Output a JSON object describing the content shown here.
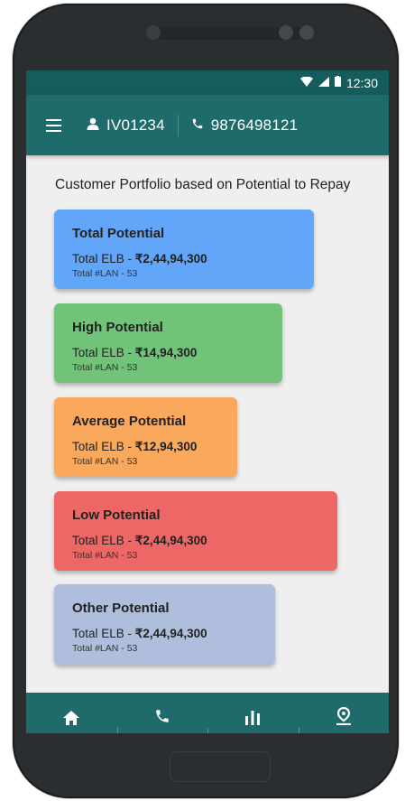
{
  "status_bar": {
    "time": "12:30",
    "icons": [
      "wifi-icon",
      "signal-icon",
      "battery-icon"
    ]
  },
  "app_bar": {
    "menu_icon": "hamburger-menu-icon",
    "user_id": "IV01234",
    "phone": "9876498121"
  },
  "subtitle": "Customer Portfolio based on Potential to Repay",
  "cards": [
    {
      "title": "Total Potential",
      "elb_label": "Total ELB - ",
      "elb_value": "₹2,44,94,300",
      "lan": "Total #LAN - 53",
      "color": "#62a6f9"
    },
    {
      "title": "High Potential",
      "elb_label": "Total ELB - ",
      "elb_value": "₹14,94,300",
      "lan": "Total #LAN - 53",
      "color": "#72c37a"
    },
    {
      "title": "Average Potential",
      "elb_label": "Total ELB - ",
      "elb_value": "₹12,94,300",
      "lan": "Total #LAN - 53",
      "color": "#f9a85c"
    },
    {
      "title": "Low Potential",
      "elb_label": "Total ELB - ",
      "elb_value": "₹2,44,94,300",
      "lan": "Total #LAN - 53",
      "color": "#ee6767"
    },
    {
      "title": "Other Potential",
      "elb_label": "Total ELB - ",
      "elb_value": "₹2,44,94,300",
      "lan": "Total #LAN - 53",
      "color": "#aebedc"
    }
  ],
  "bottom_nav": [
    "home-icon",
    "phone-call-icon",
    "bar-chart-icon",
    "location-pin-icon"
  ],
  "theme": {
    "primary": "#1f6b6b",
    "status": "#155c5c"
  }
}
